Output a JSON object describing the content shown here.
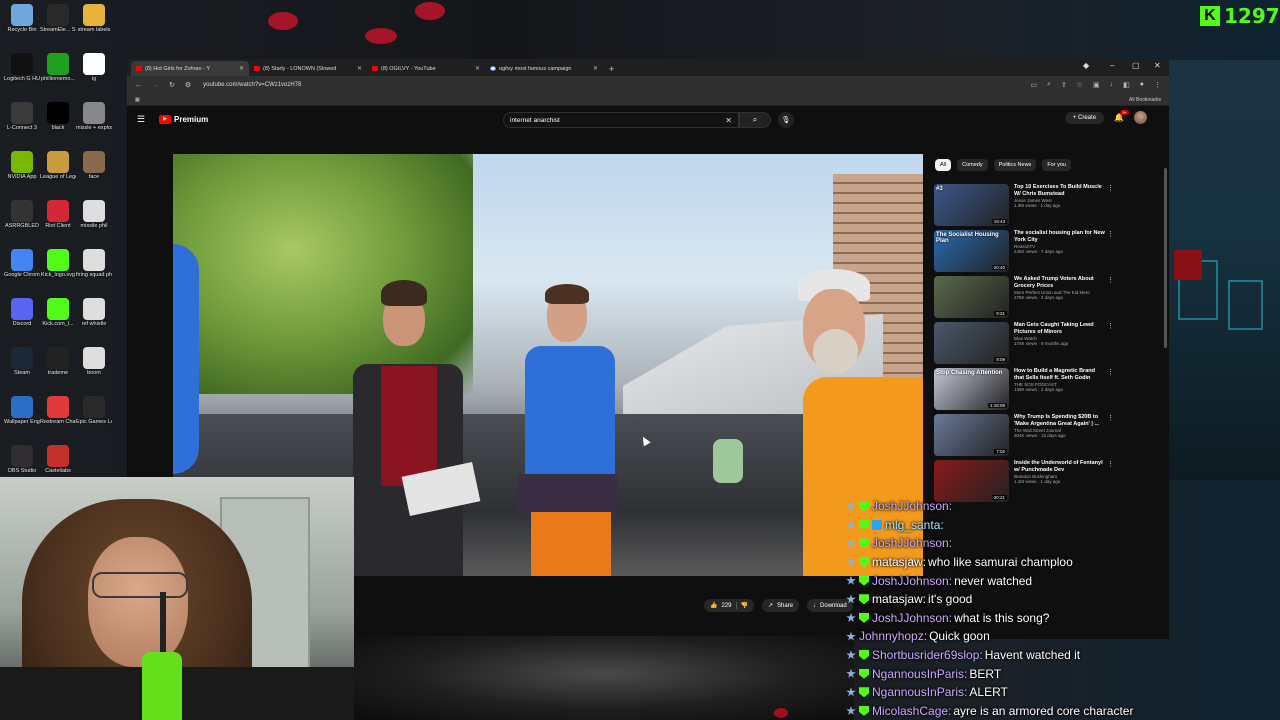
{
  "stream_overlay": {
    "viewer_count": "1297"
  },
  "desktop_icons": [
    {
      "label": "Recycle Bin",
      "color": "#6fa8dc"
    },
    {
      "label": "StreamEle... SE.Live",
      "color": "#2a2a2a"
    },
    {
      "label": "stream labels",
      "color": "#e8b33a"
    },
    {
      "label": "Logitech G HUB",
      "color": "#111"
    },
    {
      "label": "philliomemo...",
      "color": "#1fa020"
    },
    {
      "label": "ig",
      "color": "#ffffff"
    },
    {
      "label": "L-Connect 3",
      "color": "#3a3a3a"
    },
    {
      "label": "black",
      "color": "#000"
    },
    {
      "label": "missle + explosion ...",
      "color": "#888"
    },
    {
      "label": "NVIDIA App",
      "color": "#76b900"
    },
    {
      "label": "League of Legends",
      "color": "#c89b3c"
    },
    {
      "label": "face",
      "color": "#8a6a4a"
    },
    {
      "label": "ASRRGBLED",
      "color": "#333"
    },
    {
      "label": "Riot Client",
      "color": "#d32936"
    },
    {
      "label": "missile phil",
      "color": "#ddd"
    },
    {
      "label": "Google Chrome",
      "color": "#4285f4"
    },
    {
      "label": "Kick_logo.svg",
      "color": "#53fc18"
    },
    {
      "label": "firing squad phil (1)",
      "color": "#ddd"
    },
    {
      "label": "Discord",
      "color": "#5865f2"
    },
    {
      "label": "Kick.com_l...",
      "color": "#53fc18"
    },
    {
      "label": "ref whistle",
      "color": "#ddd"
    },
    {
      "label": "Steam",
      "color": "#1b2838"
    },
    {
      "label": "trademe",
      "color": "#222"
    },
    {
      "label": "boom",
      "color": "#ddd"
    },
    {
      "label": "Wallpaper Engine",
      "color": "#2a6ec8"
    },
    {
      "label": "Restream Chat",
      "color": "#e03a3a"
    },
    {
      "label": "Epic Games Launcher",
      "color": "#2a2a2a"
    },
    {
      "label": "OBS Studio",
      "color": "#302e31"
    },
    {
      "label": "Castellabs",
      "color": "#c4302b"
    }
  ],
  "browser": {
    "tabs": [
      {
        "label": "(8) Hot Girls for Zohran - Y",
        "active": true,
        "icon": "youtube-icon"
      },
      {
        "label": "(8) Starly - LONOWN (Slowed",
        "active": false,
        "icon": "youtube-icon"
      },
      {
        "label": "(8) OGILVY - YouTube",
        "active": false,
        "icon": "youtube-icon"
      },
      {
        "label": "ogilvy most famous campaign",
        "active": false,
        "icon": "google-icon"
      }
    ],
    "url": "youtube.com/watch?v=CWz1vozH78",
    "bookmarks_label": "All Bookmarks"
  },
  "youtube": {
    "logo_text": "Premium",
    "search_value": "internet anarchist",
    "create_label": "Create",
    "notification_count": "9+",
    "actions": {
      "likes": "229",
      "share": "Share",
      "download": "Download"
    },
    "chips": [
      "All",
      "Comedy",
      "Politics News",
      "For you"
    ],
    "related": [
      {
        "title": "Top 10 Exercises To Build Muscle W/ Chris Bumstead",
        "channel": "Jesse James West",
        "stats": "1.3M views · 1 day ago",
        "duration": "19:43",
        "color": "#3a5a8a",
        "overlay": "#3"
      },
      {
        "title": "The socialist housing plan for New York City",
        "channel": "ReasonTV",
        "stats": "245K views · 7 days ago",
        "duration": "20:40",
        "color": "#2a6ab0",
        "overlay": "The Socialist Housing Plan"
      },
      {
        "title": "We Asked Trump Voters About Grocery Prices",
        "channel": "More Perfect Union and The Kid Mero",
        "stats": "278K views · 4 days ago",
        "duration": "9:31",
        "color": "#5a6a4a",
        "overlay": ""
      },
      {
        "title": "Man Gets Caught Taking Lewd Pictures of Minors",
        "channel": "Blue Watch",
        "stats": "174K views · 9 months ago",
        "duration": "9:09",
        "color": "#4a5a6a",
        "overlay": ""
      },
      {
        "title": "How to Build a Magnetic Brand that Sells Itself ft. Seth Godin",
        "channel": "THE SOS PODCAST",
        "stats": "138K views · 2 days ago",
        "duration": "1:18:08",
        "color": "#c4c8d8",
        "overlay": "Stop Chasing Attention"
      },
      {
        "title": "Why Trump Is Spending $20B to 'Make Argentina Great Again' | ...",
        "channel": "The Wall Street Journal",
        "stats": "304K views · 12 days ago",
        "duration": "7:02",
        "color": "#6a7a9a",
        "overlay": ""
      },
      {
        "title": "Inside the Underworld of Fentanyl w/ Punchmade Dev",
        "channel": "Brandon Buckingham",
        "stats": "1.1M views · 1 day ago",
        "duration": "20:21",
        "color": "#8a1a1a",
        "overlay": ""
      }
    ]
  },
  "chat": [
    {
      "user": "JoshJJohnson:",
      "text": "",
      "color": "#c9a9ff",
      "badges": [
        "star",
        "mod"
      ]
    },
    {
      "user": "mlg_santa:",
      "text": "",
      "color": "#a9e6ff",
      "badges": [
        "star",
        "mod",
        "sub"
      ]
    },
    {
      "user": "JoshJJohnson:",
      "text": "",
      "color": "#c9a9ff",
      "badges": [
        "star",
        "mod"
      ]
    },
    {
      "user": "matasjaw:",
      "text": "who like samurai champloo",
      "color": "#ffffff",
      "badges": [
        "star",
        "mod"
      ]
    },
    {
      "user": "JoshJJohnson:",
      "text": "never watched",
      "color": "#c9a9ff",
      "badges": [
        "star",
        "mod"
      ]
    },
    {
      "user": "matasjaw:",
      "text": "it's good",
      "color": "#ffffff",
      "badges": [
        "star",
        "mod"
      ]
    },
    {
      "user": "JoshJJohnson:",
      "text": "what is this song?",
      "color": "#c9a9ff",
      "badges": [
        "star",
        "mod"
      ]
    },
    {
      "user": "Johnnyhopz:",
      "text": "Quick goon",
      "color": "#c9a9ff",
      "badges": [
        "star"
      ]
    },
    {
      "user": "Shortbusrider69slop:",
      "text": "Havent watched it",
      "color": "#c9a9ff",
      "badges": [
        "star",
        "mod"
      ]
    },
    {
      "user": "NgannousInParis:",
      "text": "BERT",
      "color": "#c9a9ff",
      "badges": [
        "star",
        "mod"
      ]
    },
    {
      "user": "NgannousInParis:",
      "text": "ALERT",
      "color": "#c9a9ff",
      "badges": [
        "star",
        "mod"
      ]
    },
    {
      "user": "MicolashCage:",
      "text": "ayre is an armored core character",
      "color": "#c9a9ff",
      "badges": [
        "star",
        "mod"
      ]
    }
  ]
}
